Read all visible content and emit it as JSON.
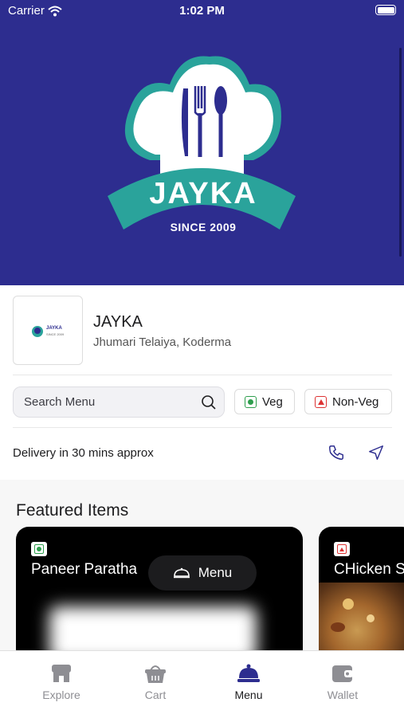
{
  "status_bar": {
    "carrier": "Carrier",
    "time": "1:02 PM"
  },
  "brand": {
    "logo_title": "JAYKA",
    "logo_since": "SINCE 2009",
    "mini_logo_title": "JAYKA",
    "mini_logo_since": "SINCE 2009"
  },
  "restaurant": {
    "name": "JAYKA",
    "address": "Jhumari Telaiya, Koderma",
    "delivery_text": "Delivery in 30 mins approx"
  },
  "search": {
    "placeholder": "Search Menu"
  },
  "filters": {
    "veg_label": "Veg",
    "nonveg_label": "Non-Veg"
  },
  "featured": {
    "title": "Featured Items",
    "items": [
      {
        "name": "Paneer Paratha",
        "type": "veg"
      },
      {
        "name": "CHicken S",
        "type": "non-veg"
      }
    ]
  },
  "menu_button": {
    "label": "Menu"
  },
  "tabs": [
    {
      "label": "Explore",
      "icon": "store-icon",
      "active": false
    },
    {
      "label": "Cart",
      "icon": "basket-icon",
      "active": false
    },
    {
      "label": "Menu",
      "icon": "cloche-icon",
      "active": true
    },
    {
      "label": "Wallet",
      "icon": "wallet-icon",
      "active": false
    }
  ],
  "colors": {
    "hero_bg": "#2d2d8f",
    "teal": "#2aa39b",
    "veg": "#2e9e4d",
    "nonveg": "#dd3333",
    "dark": "#1c1c1e"
  }
}
